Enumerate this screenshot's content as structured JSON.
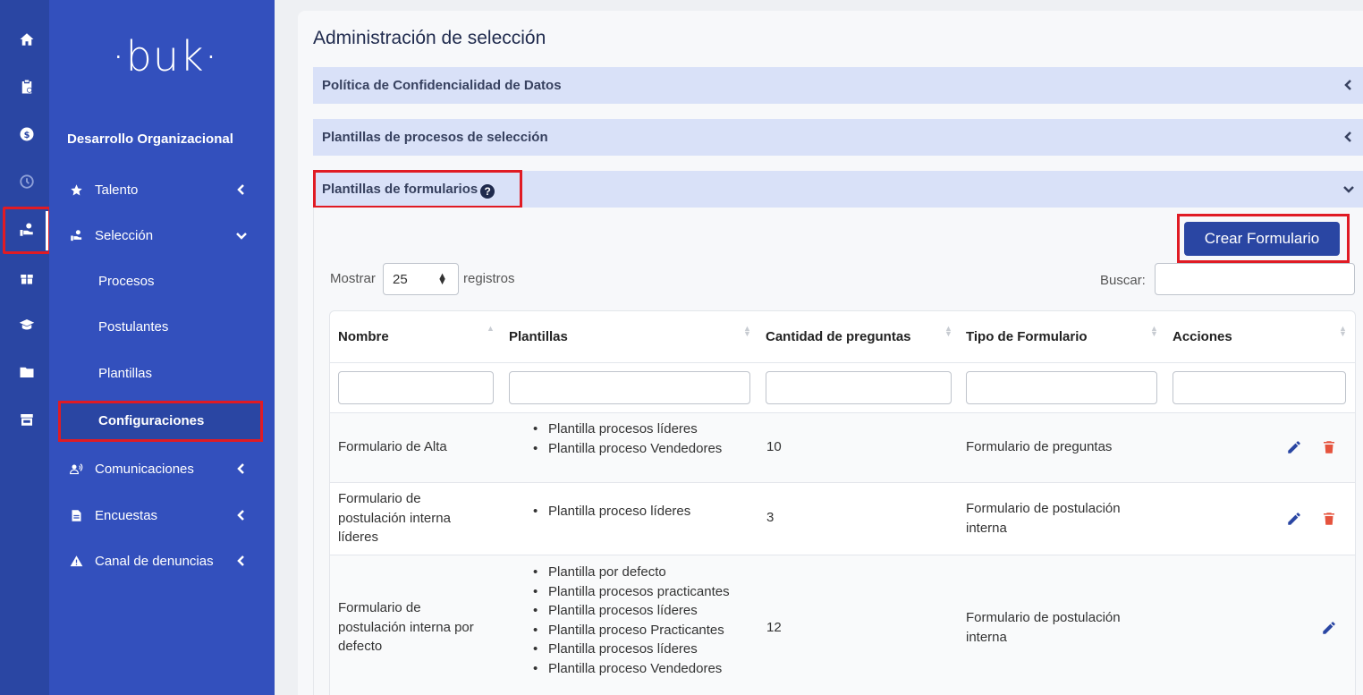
{
  "brand": {
    "logo_text": "buk"
  },
  "rail": {
    "icons": [
      "home-icon",
      "clipboard-icon",
      "dollar-icon",
      "clock-icon",
      "hand-person-icon",
      "gift-icon",
      "graduation-cap-icon",
      "folder-icon",
      "store-icon"
    ]
  },
  "sidebar": {
    "section_title": "Desarrollo Organizacional",
    "items": [
      {
        "label": "Talento",
        "icon": "star-icon"
      },
      {
        "label": "Selección",
        "icon": "hand-person-icon"
      },
      {
        "label": "Comunicaciones",
        "icon": "megaphone-icon"
      },
      {
        "label": "Encuestas",
        "icon": "document-icon"
      },
      {
        "label": "Canal de denuncias",
        "icon": "warning-icon"
      }
    ],
    "sub_items": [
      "Procesos",
      "Postulantes",
      "Plantillas",
      "Configuraciones"
    ]
  },
  "page": {
    "title": "Administración de selección",
    "accordions": [
      "Política de Confidencialidad de Datos",
      "Plantillas de procesos de selección",
      "Plantillas de formularios"
    ],
    "help_glyph": "?"
  },
  "toolbar": {
    "create_label": "Crear Formulario",
    "show_label": "Mostrar",
    "page_size": "25",
    "records_label": "registros",
    "search_label": "Buscar:"
  },
  "table": {
    "headers": [
      "Nombre",
      "Plantillas",
      "Cantidad de preguntas",
      "Tipo de Formulario",
      "Acciones"
    ],
    "rows": [
      {
        "name": "Formulario de Alta",
        "templates": [
          "Plantilla procesos líderes",
          "Plantilla proceso Vendedores"
        ],
        "count": "10",
        "type": "Formulario de preguntas"
      },
      {
        "name": "Formulario de postulación interna líderes",
        "templates": [
          "Plantilla proceso líderes"
        ],
        "count": "3",
        "type": "Formulario de postulación interna"
      },
      {
        "name": "Formulario de postulación interna por defecto",
        "templates": [
          "Plantilla por defecto",
          "Plantilla procesos practicantes",
          "Plantilla procesos líderes",
          "Plantilla proceso Practicantes",
          "Plantilla procesos líderes",
          "Plantilla proceso Vendedores"
        ],
        "count": "12",
        "type": "Formulario de postulación interna"
      }
    ]
  },
  "colors": {
    "primary": "#2a46a3",
    "sidebar": "#3350bd",
    "accordion": "#d9e1f8",
    "highlight": "#e01b24",
    "delete": "#e5533d"
  }
}
